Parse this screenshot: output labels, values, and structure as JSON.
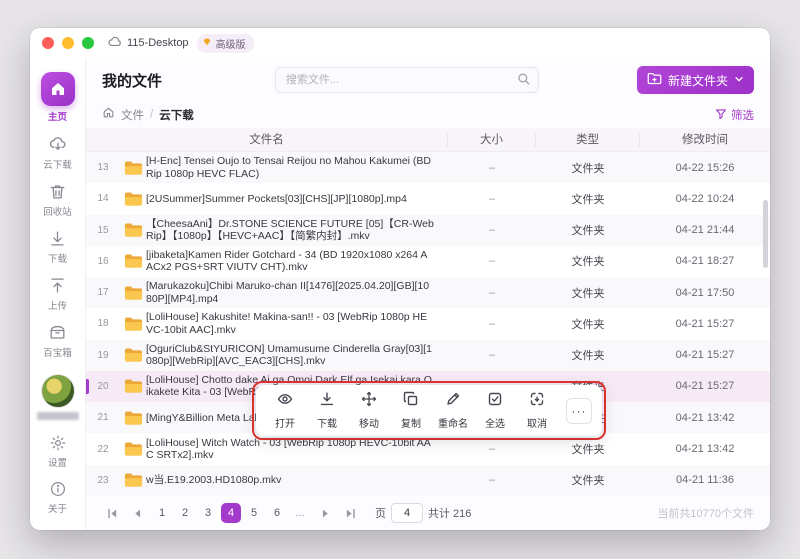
{
  "titlebar": {
    "app_title": "115-Desktop",
    "badge_label": "高级版"
  },
  "sidebar": {
    "items": [
      {
        "label": "主页"
      },
      {
        "label": "云下载"
      },
      {
        "label": "回收站"
      },
      {
        "label": "下载"
      },
      {
        "label": "上传"
      },
      {
        "label": "百宝箱"
      }
    ],
    "footer_items": [
      {
        "label": "设置"
      },
      {
        "label": "关于"
      }
    ]
  },
  "header": {
    "title": "我的文件",
    "search_placeholder": "搜索文件...",
    "new_folder_label": "新建文件夹"
  },
  "breadcrumb": {
    "root": "文件",
    "separator": "/",
    "current": "云下载",
    "filter_label": "筛选"
  },
  "table": {
    "columns": [
      "文件名",
      "大小",
      "类型",
      "修改时间"
    ],
    "rows": [
      {
        "num": "13",
        "name": "[H-Enc] Tensei Oujo to Tensai Reijou no Mahou Kakumei (BDRip 1080p HEVC FLAC)",
        "size": "–",
        "type": "文件夹",
        "time": "04-22 15:26"
      },
      {
        "num": "14",
        "name": "[2USummer]Summer Pockets[03][CHS][JP][1080p].mp4",
        "size": "–",
        "type": "文件夹",
        "time": "04-22 10:24"
      },
      {
        "num": "15",
        "name": "【CheesaAni】Dr.STONE SCIENCE FUTURE [05]【CR-WebRip】【1080p】【HEVC+AAC】【简繁内封】.mkv",
        "size": "–",
        "type": "文件夹",
        "time": "04-21 21:44"
      },
      {
        "num": "16",
        "name": "[jibaketa]Kamen Rider Gotchard - 34 (BD 1920x1080 x264 AACx2 PGS+SRT VIUTV CHT).mkv",
        "size": "–",
        "type": "文件夹",
        "time": "04-21 18:27"
      },
      {
        "num": "17",
        "name": "[Marukazoku]Chibi Maruko-chan II[1476][2025.04.20][GB][1080P][MP4].mp4",
        "size": "–",
        "type": "文件夹",
        "time": "04-21 17:50"
      },
      {
        "num": "18",
        "name": "[LoliHouse] Kakushite! Makina-san!! - 03 [WebRip 1080p HEVC-10bit AAC].mkv",
        "size": "–",
        "type": "文件夹",
        "time": "04-21 15:27"
      },
      {
        "num": "19",
        "name": "[OguriClub&StYURICON] Umamusume Cinderella Gray[03][1080p][WebRip][AVC_EAC3][CHS].mkv",
        "size": "–",
        "type": "文件夹",
        "time": "04-21 15:27"
      },
      {
        "num": "20",
        "name": "[LoliHouse] Chotto dake Ai ga Omoi Dark Elf ga Isekai kara Oikakete Kita - 03 [WebRip 1080p HEVC-10bit AAC ...",
        "size": "–",
        "type": "文件夹",
        "time": "04-21 15:27",
        "selected": true
      },
      {
        "num": "21",
        "name": "[MingY&Billion Meta Lab] mono [02][WebRip][JPCN].mkv",
        "size": "–",
        "type": "文件夹",
        "time": "04-21 13:42"
      },
      {
        "num": "22",
        "name": "[LoliHouse] Witch Watch - 03 [WebRip 1080p HEVC-10bit AAC SRTx2].mkv",
        "size": "–",
        "type": "文件夹",
        "time": "04-21 13:42"
      },
      {
        "num": "23",
        "name": "w当.E19.2003.HD1080p.mkv",
        "size": "–",
        "type": "文件夹",
        "time": "04-21 11:36"
      }
    ]
  },
  "toolbar": {
    "items": [
      {
        "label": "打开"
      },
      {
        "label": "下载"
      },
      {
        "label": "移动"
      },
      {
        "label": "复制"
      },
      {
        "label": "重命名"
      },
      {
        "label": "全选"
      },
      {
        "label": "取消"
      }
    ],
    "more_label": "···"
  },
  "pagination": {
    "pages": [
      "1",
      "2",
      "3",
      "4",
      "5",
      "6",
      "..."
    ],
    "current": "4",
    "page_label": "页",
    "page_input_value": "4",
    "total_label": "共计 216",
    "summary": "当前共10770个文件"
  }
}
